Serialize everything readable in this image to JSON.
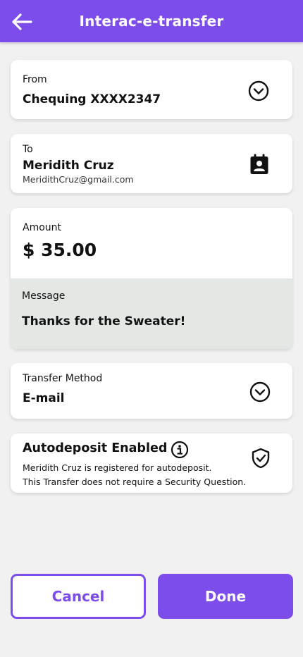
{
  "header": {
    "title": "Interac-e-transfer",
    "back_icon": "arrow-left-icon"
  },
  "from": {
    "label": "From",
    "value": "Chequing XXXX2347"
  },
  "to": {
    "label": "To",
    "name": "Meridith Cruz",
    "email": "MeridithCruz@gmail.com"
  },
  "amount": {
    "label": "Amount",
    "value": "$ 35.00"
  },
  "message": {
    "label": "Message",
    "value": "Thanks for the Sweater!"
  },
  "transfer_method": {
    "label": "Transfer Method",
    "value": "E-mail"
  },
  "autodeposit": {
    "title": "Autodeposit Enabled",
    "line1": "Meridith Cruz is registered for autodeposit.",
    "line2": "This Transfer does not require a Security Question."
  },
  "actions": {
    "cancel_label": "Cancel",
    "done_label": "Done"
  },
  "colors": {
    "accent": "#7c4dea",
    "message_bg": "#e4e8e4",
    "background": "#f1f1f1"
  }
}
